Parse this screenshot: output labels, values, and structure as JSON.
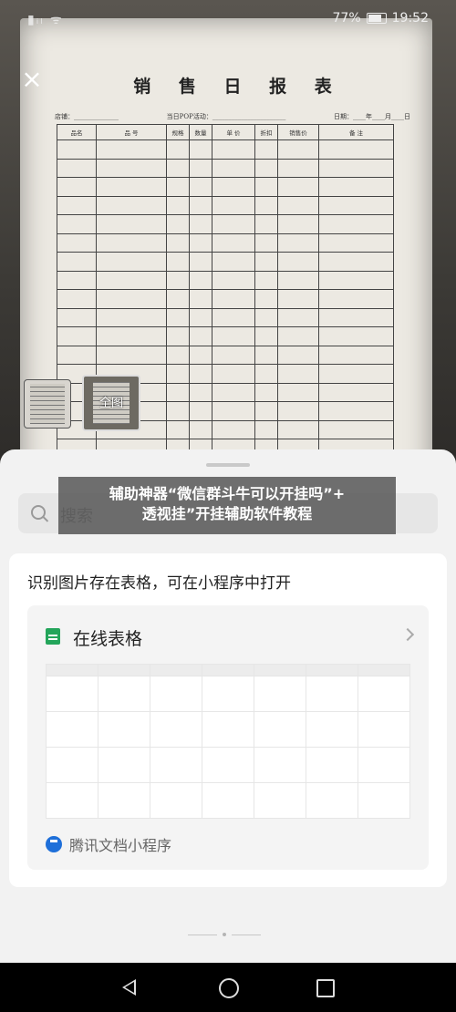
{
  "status_bar": {
    "signal": "▮ᵢₗ ᯤ",
    "battery": "77%",
    "time": "19:52"
  },
  "document": {
    "title": "销 售 日 报 表",
    "store_label": "店铺：",
    "activity_label": "当日POP活动：",
    "date_label": "日期：",
    "year": "年",
    "month": "月",
    "day": "日",
    "columns": [
      "品名",
      "品 号",
      "规格",
      "数量",
      "单 价",
      "折扣",
      "销售价",
      "备 注"
    ],
    "row_count": 17
  },
  "thumbnails": {
    "full_label": "全图"
  },
  "sheet": {
    "search_placeholder": "搜索",
    "card_title": "识别图片存在表格，可在小程序中打开",
    "option_title": "在线表格",
    "miniprogram_label": "腾讯文档小程序"
  },
  "overlay": {
    "line1": "辅助神器“微信群斗牛可以开挂吗”+",
    "line2": "透视挂”开挂辅助软件教程"
  }
}
